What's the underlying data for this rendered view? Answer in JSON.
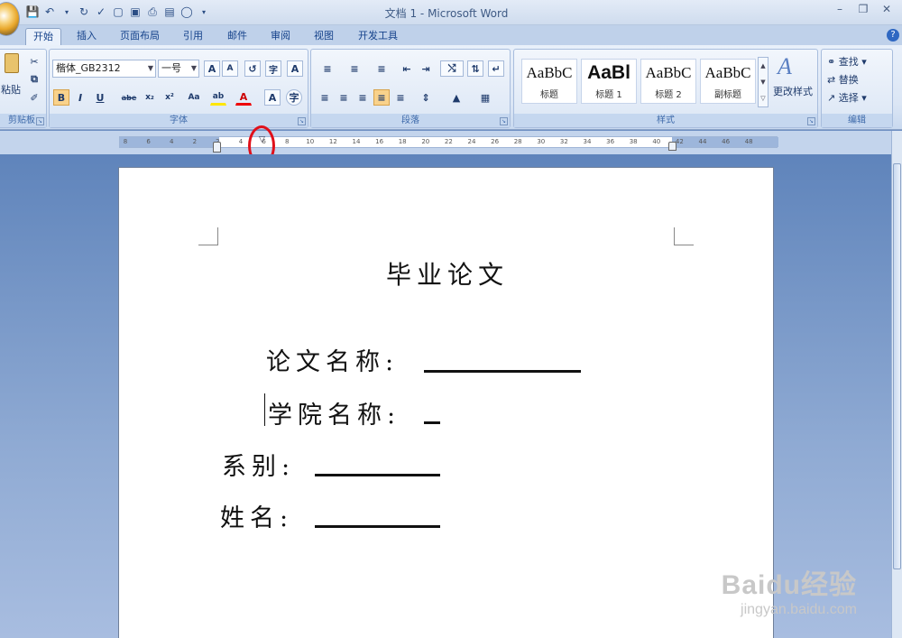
{
  "window": {
    "title": "文档 1 - Microsoft Word"
  },
  "tabs": [
    {
      "label": "开始",
      "active": true
    },
    {
      "label": "插入"
    },
    {
      "label": "页面布局"
    },
    {
      "label": "引用"
    },
    {
      "label": "邮件"
    },
    {
      "label": "审阅"
    },
    {
      "label": "视图"
    },
    {
      "label": "开发工具"
    }
  ],
  "ribbon": {
    "clipboard": {
      "paste_label": "粘贴",
      "group_label": "剪贴板"
    },
    "font": {
      "font_name": "楷体_GB2312",
      "font_size": "一号",
      "group_label": "字体"
    },
    "paragraph": {
      "group_label": "段落"
    },
    "styles": {
      "group_label": "样式",
      "cards": [
        {
          "sample": "AaBbC",
          "name": "标题"
        },
        {
          "sample": "AaBl",
          "name": "标题 1"
        },
        {
          "sample": "AaBbC",
          "name": "标题 2"
        },
        {
          "sample": "AaBbC",
          "name": "副标题"
        }
      ],
      "change_styles": "更改样式"
    },
    "editing": {
      "find": "查找",
      "replace": "替换",
      "select": "选择",
      "group_label": "编辑"
    }
  },
  "ruler": {
    "ticks": [
      "8",
      "6",
      "4",
      "2",
      "2",
      "4",
      "6",
      "8",
      "10",
      "12",
      "14",
      "16",
      "18",
      "20",
      "22",
      "24",
      "26",
      "28",
      "30",
      "32",
      "34",
      "36",
      "38",
      "40",
      "42",
      "44",
      "46",
      "48"
    ]
  },
  "document": {
    "title": "毕业论文",
    "fields": [
      {
        "label": "论文名称:"
      },
      {
        "label": "学院名称:"
      },
      {
        "label": "系别:"
      },
      {
        "label": "姓名:"
      }
    ]
  },
  "watermark": {
    "logo": "Baidu经验",
    "url": "jingyan.baidu.com"
  },
  "colors": {
    "highlight_circle": "#e0101a",
    "tab_text": "#15428b"
  }
}
